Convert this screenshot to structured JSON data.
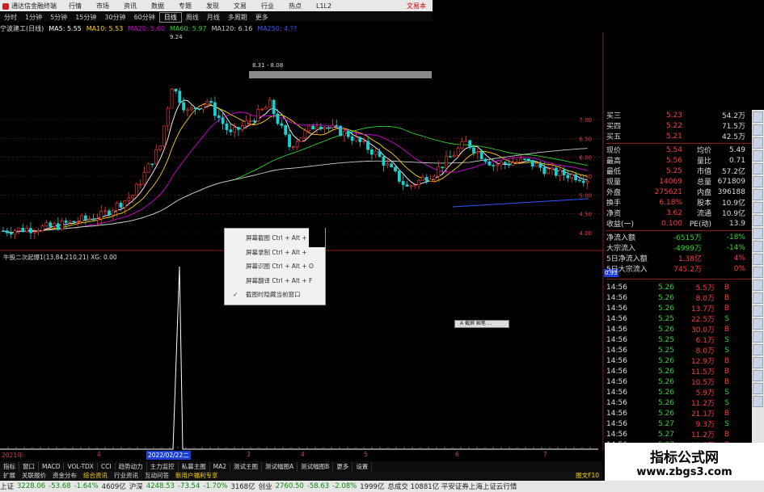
{
  "window": {
    "title": "通达信金融终端",
    "menu": [
      "行情",
      "市场",
      "资讯",
      "数据",
      "专题",
      "发现",
      "文易",
      "行业",
      "热点",
      "L1L2"
    ],
    "right_label": "文易本"
  },
  "periods": [
    "分时",
    "1分钟",
    "5分钟",
    "15分钟",
    "30分钟",
    "60分钟",
    "日线",
    "周线",
    "月线",
    "多周期",
    "更多"
  ],
  "active_period": "日线",
  "ma_legend": {
    "stock": "宁波建工(日线)",
    "items": [
      {
        "label": "MA5: 5.55",
        "color": "#ffffff"
      },
      {
        "label": "MA10: 5.53",
        "color": "#ffd700"
      },
      {
        "label": "MA20: 5.60",
        "color": "#d600d6"
      },
      {
        "label": "MA60: 5.97",
        "color": "#2fd32f"
      },
      {
        "label": "MA120: 6.16",
        "color": "#cccccc"
      },
      {
        "label": "MA250: 4.??",
        "color": "#3355ff"
      }
    ]
  },
  "price_annotations": {
    "high_label": "9.24",
    "range_label": "8.31 - 8.08"
  },
  "price_scale": [
    "7.00",
    "6.50",
    "6.00",
    "5.50",
    "5.00",
    "4.50",
    "4.00"
  ],
  "indicator": {
    "label": "牛股二次起爆1(13,84,210,21)  XG: 0.00",
    "value_tag": "0.93"
  },
  "context_menu": [
    {
      "label": "屏幕截图 Ctrl + Alt + A",
      "checked": false
    },
    {
      "label": "屏幕录制 Ctrl + Alt +",
      "checked": false
    },
    {
      "label": "屏幕识图 Ctrl + Alt + O",
      "checked": false
    },
    {
      "label": "屏幕翻译 Ctrl + Alt + F",
      "checked": false
    },
    {
      "label": "截图时隐藏当前窗口",
      "checked": true
    }
  ],
  "tiny_toolbar": "A 截屏 画笔 ...",
  "quote_top": [
    {
      "k": "买三",
      "v": "5.23",
      "n": "54.2万"
    },
    {
      "k": "买四",
      "v": "5.22",
      "n": "71.5万"
    },
    {
      "k": "买五",
      "v": "5.21",
      "n": "42.5万"
    }
  ],
  "quote_stats": [
    {
      "k": "现价",
      "v": "5.54",
      "k2": "均价",
      "v2": "5.49"
    },
    {
      "k": "最高",
      "v": "5.56",
      "k2": "量比",
      "v2": "0.71"
    },
    {
      "k": "最低",
      "v": "5.25",
      "k2": "市值",
      "v2": "57.2亿"
    },
    {
      "k": "现量",
      "v": "14069",
      "k2": "总量",
      "v2": "671809"
    },
    {
      "k": "外盘",
      "v": "275621",
      "k2": "内盘",
      "v2": "396188"
    },
    {
      "k": "换手",
      "v": "6.18%",
      "k2": "股本",
      "v2": "10.9亿"
    },
    {
      "k": "净资",
      "v": "3.62",
      "k2": "流通",
      "v2": "10.9亿"
    },
    {
      "k": "收益(一)",
      "v": "0.100",
      "k2": "PE(动)",
      "v2": "13.9"
    }
  ],
  "flows": [
    {
      "k": "净流入额",
      "v": "-6515万",
      "p": "-18%"
    },
    {
      "k": "大宗流入",
      "v": "-4999万",
      "p": "-14%"
    },
    {
      "k": "5日净流入额",
      "v": "1.38亿",
      "p": "4%"
    },
    {
      "k": "5日大宗流入",
      "v": "745.2万",
      "p": "0%"
    }
  ],
  "ticks": [
    {
      "t": "14:56",
      "p": "5.26",
      "v": "5.5万",
      "s": "B"
    },
    {
      "t": "14:56",
      "p": "5.26",
      "v": "8.0万",
      "s": "B"
    },
    {
      "t": "14:56",
      "p": "5.26",
      "v": "13.7万",
      "s": "B"
    },
    {
      "t": "14:56",
      "p": "5.25",
      "v": "22.5万",
      "s": "S"
    },
    {
      "t": "14:56",
      "p": "5.26",
      "v": "30.0万",
      "s": "B"
    },
    {
      "t": "14:56",
      "p": "5.25",
      "v": "6.1万",
      "s": "S"
    },
    {
      "t": "14:56",
      "p": "5.25",
      "v": "8.0万",
      "s": "S"
    },
    {
      "t": "14:56",
      "p": "5.26",
      "v": "12.9万",
      "s": "B"
    },
    {
      "t": "14:56",
      "p": "5.26",
      "v": "11.5万",
      "s": "B"
    },
    {
      "t": "14:56",
      "p": "5.26",
      "v": "10.5万",
      "s": "B"
    },
    {
      "t": "14:56",
      "p": "5.26",
      "v": "5.9万",
      "s": "S"
    },
    {
      "t": "14:56",
      "p": "5.26",
      "v": "11.2万",
      "s": "S"
    },
    {
      "t": "14:56",
      "p": "5.26",
      "v": "21.1万",
      "s": "B"
    },
    {
      "t": "14:56",
      "p": "5.27",
      "v": "9.3万",
      "s": "S"
    },
    {
      "t": "14:56",
      "p": "5.27",
      "v": "11.2万",
      "s": "B"
    },
    {
      "t": "14:56",
      "p": "5.27",
      "v": "13.5万",
      "s": "B"
    },
    {
      "t": "14:56",
      "p": "5.26",
      "v": "9.3万",
      "s": "B"
    },
    {
      "t": "14:56",
      "p": "5.27",
      "v": "15.5万",
      "s": "B"
    }
  ],
  "time_axis": [
    "2021年",
    "4",
    "2022/02/22二",
    "3",
    "4",
    "5",
    "6",
    "7"
  ],
  "bottom_tabs": [
    "指标",
    "窗口",
    "MACD",
    "VOL-TDX",
    "CCI",
    "趋势动力",
    "主力监控",
    "私募主图",
    "MA2",
    "测试主图",
    "测试幅图A",
    "测试幅图B",
    "更多",
    "设置"
  ],
  "sub_tabs": [
    "扩展",
    "关联报价",
    "资金分布",
    "综合资讯",
    "行业资讯",
    "互动问答",
    "新用户福利专享"
  ],
  "bottom_right": "图文F10",
  "statusbar": [
    {
      "label": "上证",
      "value": "3228.06",
      "chg": "-53.68",
      "pct": "-1.64%",
      "amt": "4609亿"
    },
    {
      "label": "沪深",
      "value": "4248.53",
      "chg": "-73.54",
      "pct": "-1.70%",
      "amt": "3168亿"
    },
    {
      "label": "创业",
      "value": "2760.50",
      "chg": "-58.63",
      "pct": "-2.08%",
      "amt": "1999亿"
    }
  ],
  "status_tail": "总成交 10881亿 平安证券上海上证云行情",
  "watermark": {
    "title": "指标公式网",
    "url": "www.zbgs3.com"
  },
  "colors": {
    "up": "#ff3b3b",
    "down": "#19d0d0",
    "bg": "#000000",
    "grid": "#6a1b1b"
  }
}
